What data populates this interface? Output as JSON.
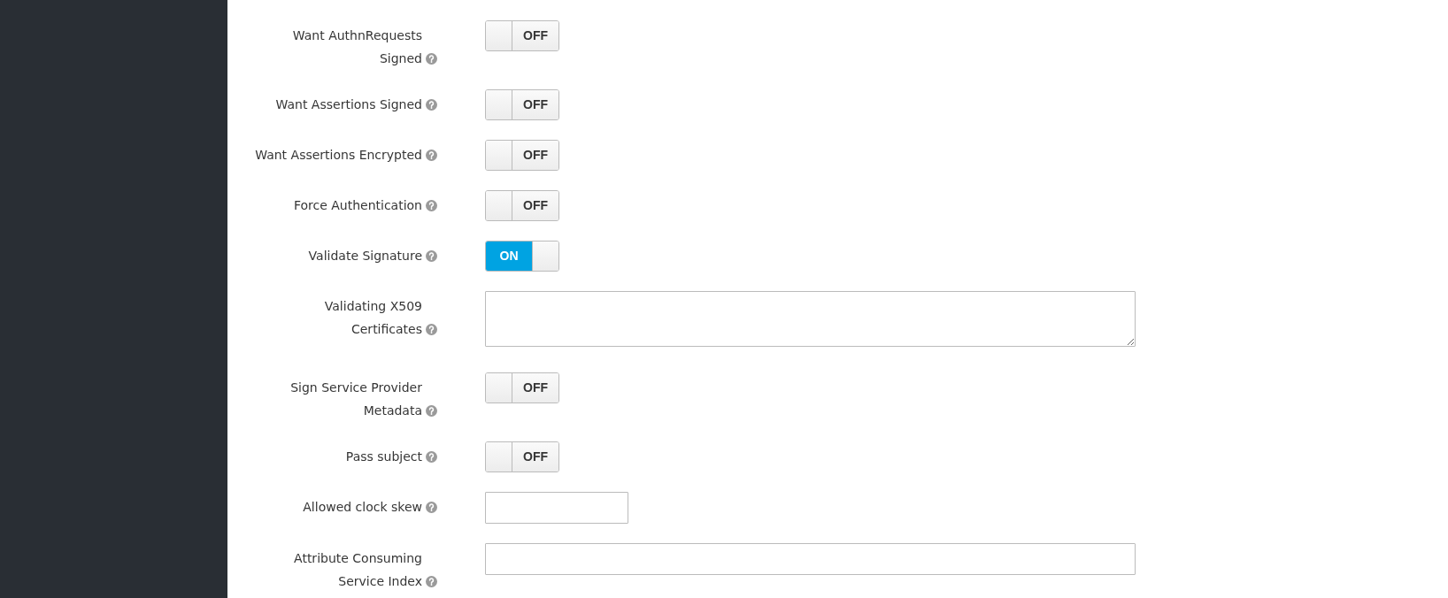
{
  "fields": [
    {
      "kind": "toggle",
      "label": "Want AuthnRequests Signed",
      "on": false,
      "text": "OFF"
    },
    {
      "kind": "toggle",
      "label": "Want Assertions Signed",
      "on": false,
      "text": "OFF"
    },
    {
      "kind": "toggle",
      "label": "Want Assertions Encrypted",
      "on": false,
      "text": "OFF"
    },
    {
      "kind": "toggle",
      "label": "Force Authentication",
      "on": false,
      "text": "OFF"
    },
    {
      "kind": "toggle",
      "label": "Validate Signature",
      "on": true,
      "text": "ON"
    },
    {
      "kind": "textarea",
      "label": "Validating X509 Certificates"
    },
    {
      "kind": "toggle",
      "label": "Sign Service Provider Metadata",
      "on": false,
      "text": "OFF"
    },
    {
      "kind": "toggle",
      "label": "Pass subject",
      "on": false,
      "text": "OFF"
    },
    {
      "kind": "short-input",
      "label": "Allowed clock skew"
    },
    {
      "kind": "long-input",
      "label": "Attribute Consuming Service Index"
    }
  ]
}
